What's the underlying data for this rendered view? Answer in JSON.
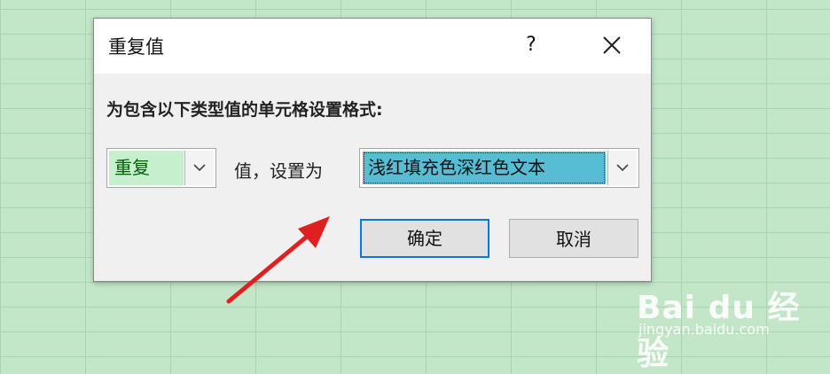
{
  "dialog": {
    "title": "重复值",
    "help_label": "?",
    "prompt": "为包含以下类型值的单元格设置格式:",
    "type_value": "重复",
    "middle_label": "值，设置为",
    "format_value": "浅红填充色深红色文本",
    "ok_label": "确定",
    "cancel_label": "取消"
  },
  "annotation": {
    "arrow_color": "#e02020"
  },
  "watermark": {
    "main": "Bai du 经验",
    "sub": "jingyan.baidu.com"
  },
  "colors": {
    "sheet_bg": "#c3e6c9",
    "type_fill": "#c6efce",
    "type_text": "#006100",
    "format_highlight": "#56bdd4",
    "ok_border": "#0a78d7"
  }
}
